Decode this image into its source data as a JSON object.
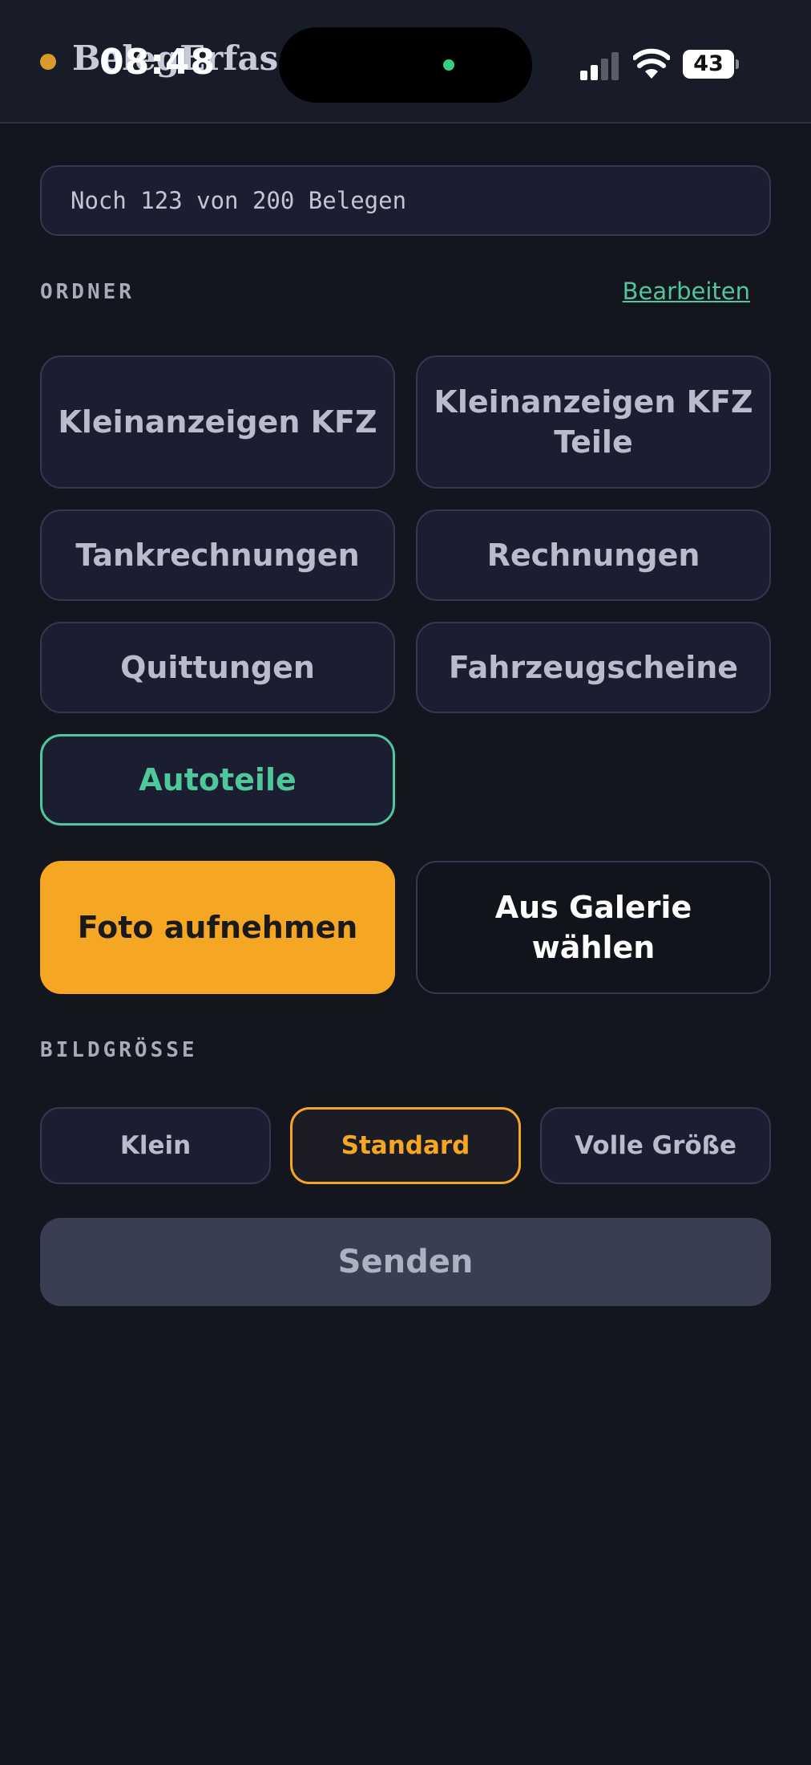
{
  "status_bar": {
    "time": "08:48",
    "battery": "43",
    "colors": {
      "island_dot": "#33d17a",
      "signal_active": "#ffffff",
      "signal_inactive": "#5a5c66"
    }
  },
  "header": {
    "title": "BelegErfass",
    "dot_color": "#d79a2b"
  },
  "quota": {
    "text": "Noch 123 von 200 Belegen"
  },
  "folders": {
    "label": "ORDNER",
    "edit_label": "Bearbeiten",
    "edit_color": "#4ec79a",
    "items": [
      {
        "label": "Kleinanzeigen KFZ",
        "selected": false
      },
      {
        "label": "Kleinanzeigen KFZ Teile",
        "selected": false
      },
      {
        "label": "Tankrechnungen",
        "selected": false
      },
      {
        "label": "Rechnungen",
        "selected": false
      },
      {
        "label": "Quittungen",
        "selected": false
      },
      {
        "label": "Fahrzeugscheine",
        "selected": false
      },
      {
        "label": "Autoteile",
        "selected": true
      }
    ]
  },
  "actions": {
    "take_photo": "Foto aufnehmen",
    "choose_gallery": "Aus Galerie wählen"
  },
  "image_size": {
    "label": "BILDGRÖSSE",
    "options": [
      {
        "label": "Klein",
        "selected": false
      },
      {
        "label": "Standard",
        "selected": true
      },
      {
        "label": "Volle Größe",
        "selected": false
      }
    ]
  },
  "send": {
    "label": "Senden"
  }
}
